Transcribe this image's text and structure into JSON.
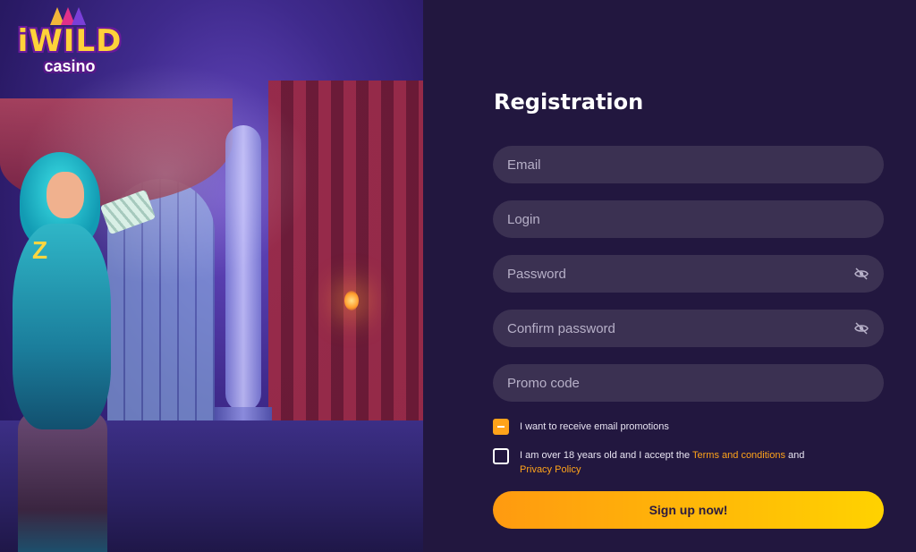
{
  "brand": {
    "logo_main": "iWILD",
    "logo_sub": "casino"
  },
  "form": {
    "title": "Registration",
    "fields": {
      "email": {
        "placeholder": "Email",
        "value": ""
      },
      "login": {
        "placeholder": "Login",
        "value": ""
      },
      "password": {
        "placeholder": "Password",
        "value": ""
      },
      "confirm_password": {
        "placeholder": "Confirm password",
        "value": ""
      },
      "promo": {
        "placeholder": "Promo code",
        "value": ""
      }
    },
    "email_promotions": {
      "label": "I want to receive email promotions",
      "checked": true
    },
    "age_terms": {
      "text_before": "I am over 18 years old and I accept the ",
      "terms_link": "Terms and conditions",
      "text_middle": " and ",
      "privacy_link": "Privacy Policy",
      "checked": false
    },
    "submit_label": "Sign up now!"
  },
  "colors": {
    "background": "#22173f",
    "field_bg": "#3b3152",
    "accent": "#ffa31a",
    "button_gradient_start": "#ff9a10",
    "button_gradient_end": "#ffd200"
  },
  "icons": {
    "password_toggle": "eye-slash-icon",
    "confirm_password_toggle": "eye-slash-icon"
  }
}
